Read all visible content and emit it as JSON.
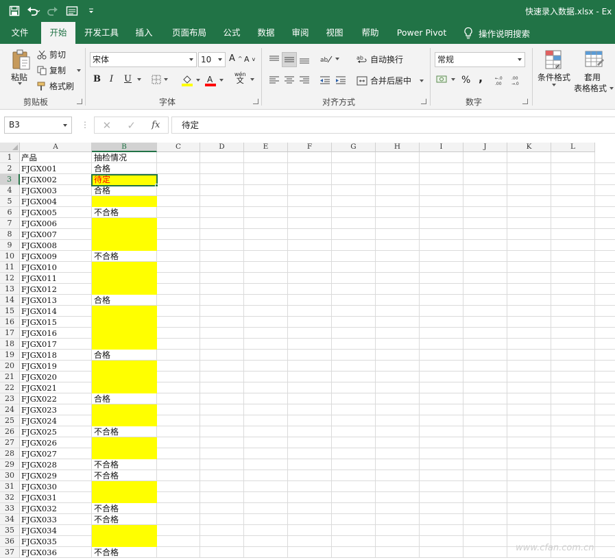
{
  "window": {
    "title": "快速录入数据.xlsx  -  Ex"
  },
  "tabs": [
    {
      "label": "文件",
      "active": false
    },
    {
      "label": "开始",
      "active": true
    },
    {
      "label": "开发工具",
      "active": false
    },
    {
      "label": "插入",
      "active": false
    },
    {
      "label": "页面布局",
      "active": false
    },
    {
      "label": "公式",
      "active": false
    },
    {
      "label": "数据",
      "active": false
    },
    {
      "label": "审阅",
      "active": false
    },
    {
      "label": "视图",
      "active": false
    },
    {
      "label": "帮助",
      "active": false
    },
    {
      "label": "Power Pivot",
      "active": false
    }
  ],
  "tell_me": "操作说明搜索",
  "ribbon": {
    "clipboard": {
      "label": "剪贴板",
      "paste": "粘贴",
      "cut": "剪切",
      "copy": "复制",
      "format_painter": "格式刷"
    },
    "font": {
      "label": "字体",
      "font_name": "宋体",
      "font_size": "10",
      "bold": "B",
      "italic": "I",
      "underline": "U",
      "phonetic_top": "wén",
      "phonetic_bottom": "文",
      "fill_color": "#ffff00",
      "font_color": "#ff0000"
    },
    "alignment": {
      "label": "对齐方式",
      "wrap_text": "自动换行",
      "merge_center": "合并后居中"
    },
    "number": {
      "label": "数字",
      "format": "常规",
      "percent": "%",
      "comma": ","
    },
    "styles": {
      "conditional_formatting": "条件格式",
      "format_as_table_line1": "套用",
      "format_as_table_line2": "表格格式"
    }
  },
  "formula_bar": {
    "name_box": "B3",
    "content": "待定"
  },
  "sheet": {
    "columns": [
      "A",
      "B",
      "C",
      "D",
      "E",
      "F",
      "G",
      "H",
      "I",
      "J",
      "K",
      "L"
    ],
    "selected_column": "B",
    "selected_row": 3,
    "rows": [
      {
        "n": 1,
        "a": "产品",
        "b": "抽检情况",
        "fill": false
      },
      {
        "n": 2,
        "a": "FJGX001",
        "b": "合格",
        "fill": false
      },
      {
        "n": 3,
        "a": "FJGX002",
        "b": "待定",
        "fill": true,
        "red": true
      },
      {
        "n": 4,
        "a": "FJGX003",
        "b": "合格",
        "fill": false
      },
      {
        "n": 5,
        "a": "FJGX004",
        "b": "",
        "fill": true
      },
      {
        "n": 6,
        "a": "FJGX005",
        "b": "不合格",
        "fill": false
      },
      {
        "n": 7,
        "a": "FJGX006",
        "b": "",
        "fill": true
      },
      {
        "n": 8,
        "a": "FJGX007",
        "b": "",
        "fill": true
      },
      {
        "n": 9,
        "a": "FJGX008",
        "b": "",
        "fill": true
      },
      {
        "n": 10,
        "a": "FJGX009",
        "b": "不合格",
        "fill": false
      },
      {
        "n": 11,
        "a": "FJGX010",
        "b": "",
        "fill": true
      },
      {
        "n": 12,
        "a": "FJGX011",
        "b": "",
        "fill": true
      },
      {
        "n": 13,
        "a": "FJGX012",
        "b": "",
        "fill": true
      },
      {
        "n": 14,
        "a": "FJGX013",
        "b": "合格",
        "fill": false
      },
      {
        "n": 15,
        "a": "FJGX014",
        "b": "",
        "fill": true
      },
      {
        "n": 16,
        "a": "FJGX015",
        "b": "",
        "fill": true
      },
      {
        "n": 17,
        "a": "FJGX016",
        "b": "",
        "fill": true
      },
      {
        "n": 18,
        "a": "FJGX017",
        "b": "",
        "fill": true
      },
      {
        "n": 19,
        "a": "FJGX018",
        "b": "合格",
        "fill": false
      },
      {
        "n": 20,
        "a": "FJGX019",
        "b": "",
        "fill": true
      },
      {
        "n": 21,
        "a": "FJGX020",
        "b": "",
        "fill": true
      },
      {
        "n": 22,
        "a": "FJGX021",
        "b": "",
        "fill": true
      },
      {
        "n": 23,
        "a": "FJGX022",
        "b": "合格",
        "fill": false
      },
      {
        "n": 24,
        "a": "FJGX023",
        "b": "",
        "fill": true
      },
      {
        "n": 25,
        "a": "FJGX024",
        "b": "",
        "fill": true
      },
      {
        "n": 26,
        "a": "FJGX025",
        "b": "不合格",
        "fill": false
      },
      {
        "n": 27,
        "a": "FJGX026",
        "b": "",
        "fill": true
      },
      {
        "n": 28,
        "a": "FJGX027",
        "b": "",
        "fill": true
      },
      {
        "n": 29,
        "a": "FJGX028",
        "b": "不合格",
        "fill": false
      },
      {
        "n": 30,
        "a": "FJGX029",
        "b": "不合格",
        "fill": false
      },
      {
        "n": 31,
        "a": "FJGX030",
        "b": "",
        "fill": true
      },
      {
        "n": 32,
        "a": "FJGX031",
        "b": "",
        "fill": true
      },
      {
        "n": 33,
        "a": "FJGX032",
        "b": "不合格",
        "fill": false
      },
      {
        "n": 34,
        "a": "FJGX033",
        "b": "不合格",
        "fill": false
      },
      {
        "n": 35,
        "a": "FJGX034",
        "b": "",
        "fill": true
      },
      {
        "n": 36,
        "a": "FJGX035",
        "b": "",
        "fill": true
      },
      {
        "n": 37,
        "a": "FJGX036",
        "b": "不合格",
        "fill": false
      }
    ]
  },
  "watermark": "www.cfan.com.cn"
}
